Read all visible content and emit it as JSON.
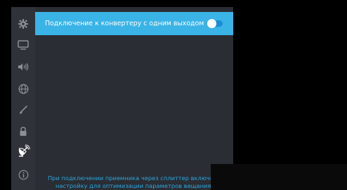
{
  "sidebar": {
    "items": [
      {
        "icon": "gear-icon"
      },
      {
        "icon": "monitor-icon"
      },
      {
        "icon": "speaker-icon"
      },
      {
        "icon": "globe-icon"
      },
      {
        "icon": "brush-icon"
      },
      {
        "icon": "lock-icon"
      },
      {
        "icon": "satellite-dish-icon",
        "active": true
      },
      {
        "icon": "info-icon"
      }
    ]
  },
  "settings": {
    "option_label": "Подключение к конвертеру с одним выходом",
    "toggle_state": "off"
  },
  "hint": {
    "line1": "При подключении приемника через сплиттер включите",
    "line2": "настройку для оптимизации параметров вещания."
  },
  "colors": {
    "highlight": "#3ab3e6",
    "hint_text": "#2aa6df",
    "panel": "#2a2d33",
    "rail": "#2f3339"
  }
}
